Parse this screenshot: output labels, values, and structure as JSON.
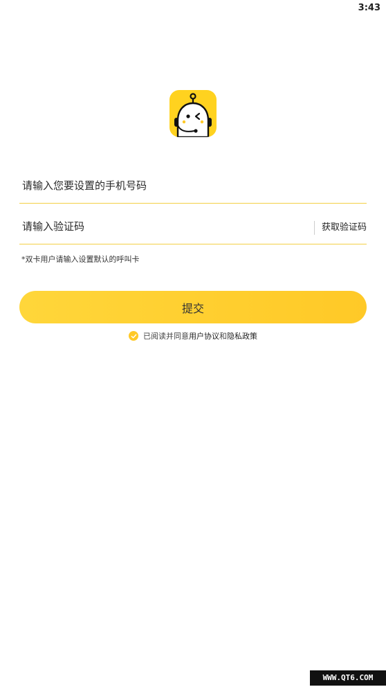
{
  "status_bar": {
    "time": "3:43"
  },
  "logo": {
    "icon": "robot-mascot-icon",
    "background": "#ffd21f"
  },
  "form": {
    "phone_placeholder": "请输入您要设置的手机号码",
    "code_placeholder": "请输入验证码",
    "get_code_label": "获取验证码",
    "hint": "*双卡用户请输入设置默认的呼叫卡",
    "submit_label": "提交"
  },
  "agreement": {
    "prefix": "已阅读并同意",
    "user_agreement": "用户协议",
    "conjunction": "和",
    "privacy_policy": "隐私政策"
  },
  "watermark": "WWW.QT6.COM",
  "colors": {
    "accent": "#ffc927",
    "underline": "#f4cf44"
  }
}
